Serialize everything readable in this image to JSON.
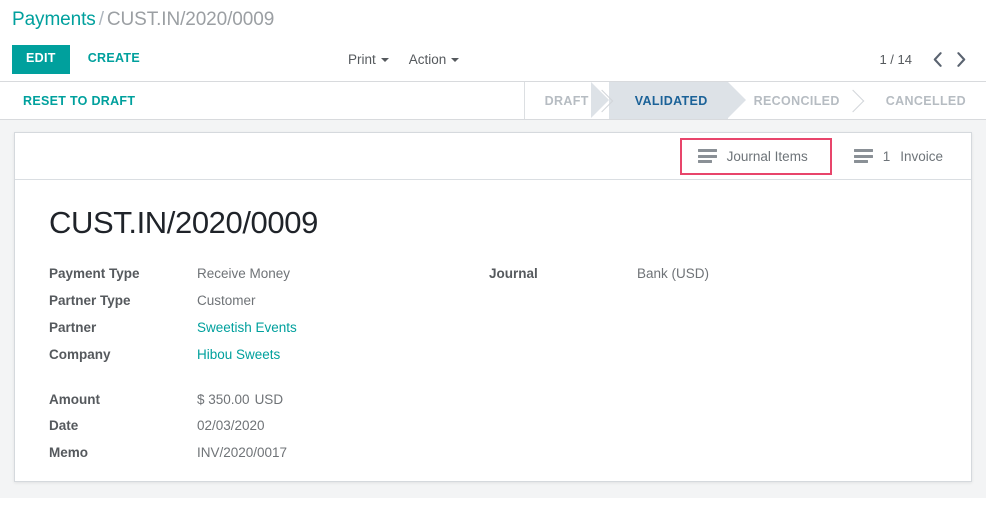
{
  "breadcrumb": {
    "root": "Payments",
    "separator": "/",
    "current": "CUST.IN/2020/0009"
  },
  "control_panel": {
    "edit_label": "EDIT",
    "create_label": "CREATE",
    "print_label": "Print",
    "action_label": "Action",
    "pager": {
      "count": "1 / 14",
      "prev_icon": "chevron-left-icon",
      "next_icon": "chevron-right-icon"
    }
  },
  "statusbar": {
    "reset_label": "RESET TO DRAFT",
    "stages": [
      {
        "label": "DRAFT",
        "active": false
      },
      {
        "label": "VALIDATED",
        "active": true
      },
      {
        "label": "RECONCILED",
        "active": false
      },
      {
        "label": "CANCELLED",
        "active": false
      }
    ]
  },
  "smart_buttons": [
    {
      "icon": "bars-icon",
      "count": "",
      "label": "Journal Items",
      "annotated": true
    },
    {
      "icon": "bars-icon",
      "count": "1",
      "label": "Invoice",
      "annotated": false
    }
  ],
  "record": {
    "title": "CUST.IN/2020/0009",
    "left_fields": [
      {
        "label": "Payment Type",
        "value": "Receive Money",
        "link": false
      },
      {
        "label": "Partner Type",
        "value": "Customer",
        "link": false
      },
      {
        "label": "Partner",
        "value": "Sweetish Events",
        "link": true
      },
      {
        "label": "Company",
        "value": "Hibou Sweets",
        "link": true
      }
    ],
    "left_fields_second": [
      {
        "label": "Amount",
        "value": "$ 350.00",
        "currency": "USD",
        "link": false
      },
      {
        "label": "Date",
        "value": "02/03/2020",
        "link": false
      },
      {
        "label": "Memo",
        "value": "INV/2020/0017",
        "link": false
      }
    ],
    "right_fields": [
      {
        "label": "Journal",
        "value": "Bank (USD)",
        "link": false
      }
    ]
  },
  "colors": {
    "accent_teal": "#00a09d",
    "stage_active_text": "#1b6298",
    "stage_active_bg": "#dde2e7",
    "annotation_pink": "#e8456b",
    "muted_text": "#9b9fa3"
  }
}
